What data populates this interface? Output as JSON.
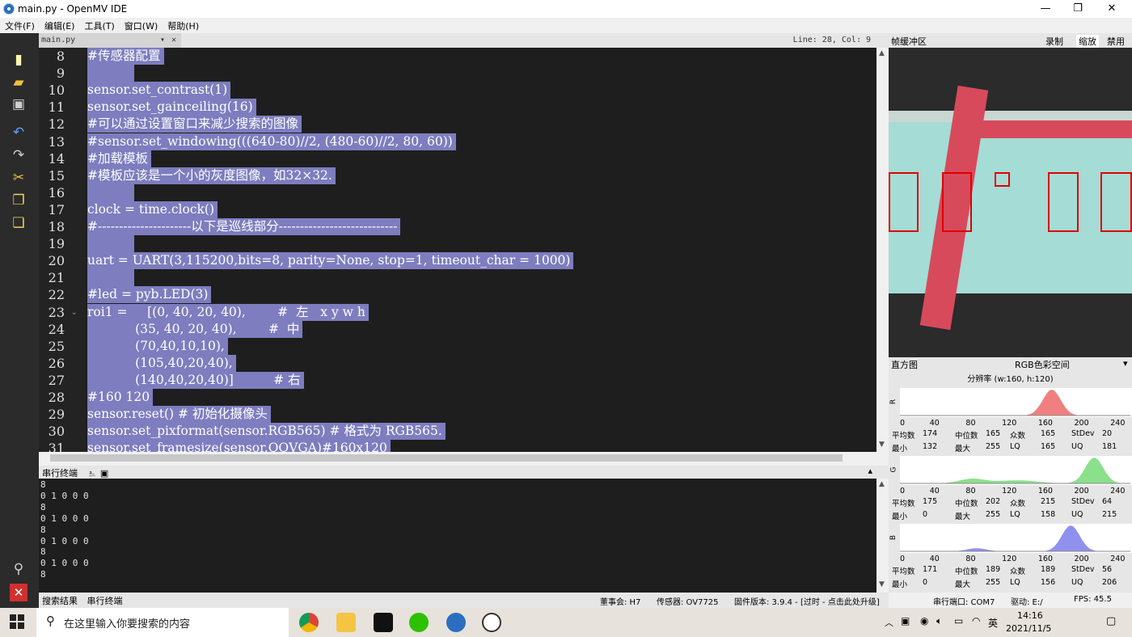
{
  "window": {
    "title": "main.py - OpenMV IDE",
    "minimize": "—",
    "restore": "❐",
    "close": "✕"
  },
  "menu": [
    "文件(F)",
    "编辑(E)",
    "工具(T)",
    "窗口(W)",
    "帮助(H)"
  ],
  "editor_tab": {
    "filename": "main.py",
    "dropdown": "▾",
    "close": "✕",
    "position": "Line: 28, Col: 9"
  },
  "code_lines": [
    {
      "n": "8",
      "text": "#传感器配置"
    },
    {
      "n": "9",
      "text": ""
    },
    {
      "n": "10",
      "text": "sensor.set_contrast(1)"
    },
    {
      "n": "11",
      "text": "sensor.set_gainceiling(16)"
    },
    {
      "n": "12",
      "text": "#可以通过设置窗口来减少搜索的图像"
    },
    {
      "n": "13",
      "text": "#sensor.set_windowing(((640-80)//2, (480-60)//2, 80, 60))"
    },
    {
      "n": "14",
      "text": "#加载模板"
    },
    {
      "n": "15",
      "text": "#模板应该是一个小的灰度图像，如32×32."
    },
    {
      "n": "16",
      "text": ""
    },
    {
      "n": "17",
      "text": "clock = time.clock()"
    },
    {
      "n": "18",
      "text": "#----------------------以下是巡线部分----------------------------"
    },
    {
      "n": "19",
      "text": ""
    },
    {
      "n": "20",
      "text": "uart = UART(3,115200,bits=8, parity=None, stop=1, timeout_char = 1000)"
    },
    {
      "n": "21",
      "text": ""
    },
    {
      "n": "22",
      "text": "#led = pyb.LED(3)"
    },
    {
      "n": "23",
      "text": "roi1 =     [(0, 40, 20, 40),        #  左   x y w h"
    },
    {
      "n": "24",
      "text": "            (35, 40, 20, 40),        #  中"
    },
    {
      "n": "25",
      "text": "            (70,40,10,10),"
    },
    {
      "n": "26",
      "text": "            (105,40,20,40),"
    },
    {
      "n": "27",
      "text": "            (140,40,20,40)]          # 右"
    },
    {
      "n": "28",
      "text": "#160 120"
    },
    {
      "n": "29",
      "text": "sensor.reset() # 初始化摄像头"
    },
    {
      "n": "30",
      "text": "sensor.set_pixformat(sensor.RGB565) # 格式为 RGB565."
    },
    {
      "n": "31",
      "text": "sensor.set_framesize(sensor.QQVGA)#160x120"
    }
  ],
  "serial": {
    "title": "串行终端",
    "lines": [
      "8",
      "0 1 0 0 0",
      "8",
      "0 1 0 0 0",
      "8",
      "0 1 0 0 0",
      "8",
      "0 1 0 0 0",
      "8"
    ]
  },
  "bottom_tabs": [
    "搜索结果",
    "串行终端"
  ],
  "status": {
    "board": "董事会: H7",
    "sensor": "传感器: OV7725",
    "firmware": "固件版本: 3.9.4 - [过时 - 点击此处升级]",
    "port": "串行端口: COM7",
    "drive": "驱动: E:/",
    "fps": "FPS: 45.5"
  },
  "framebuffer": {
    "title": "帧缓冲区",
    "record": "录制",
    "zoom": "缩放",
    "disable": "禁用"
  },
  "histogram": {
    "title": "直方图",
    "colorspace": "RGB色彩空间",
    "resolution": "分辨率 (w:160, h:120)",
    "ticks": [
      "0",
      "40",
      "80",
      "120",
      "160",
      "200",
      "240"
    ],
    "channels": [
      {
        "label": "R",
        "color": "#f08080",
        "peak": 168,
        "stats": {
          "mean": "174",
          "median": "165",
          "mode": "165",
          "stdev": "20",
          "min": "132",
          "max": "255",
          "lq": "165",
          "uq": "181"
        }
      },
      {
        "label": "G",
        "color": "#8be08b",
        "peak": 215,
        "stats": {
          "mean": "175",
          "median": "202",
          "mode": "215",
          "stdev": "64",
          "min": "0",
          "max": "255",
          "lq": "158",
          "uq": "215"
        }
      },
      {
        "label": "B",
        "color": "#9090ee",
        "peak": 189,
        "stats": {
          "mean": "171",
          "median": "189",
          "mode": "189",
          "stdev": "56",
          "min": "0",
          "max": "255",
          "lq": "156",
          "uq": "206"
        }
      }
    ],
    "labels": {
      "mean": "平均数",
      "median": "中位数",
      "mode": "众数",
      "stdev": "StDev",
      "min": "最小",
      "max": "最大",
      "lq": "LQ",
      "uq": "UQ"
    }
  },
  "taskbar": {
    "search_placeholder": "在这里输入你要搜索的内容",
    "time": "14:16",
    "date": "2021/11/5",
    "ime": "英"
  }
}
